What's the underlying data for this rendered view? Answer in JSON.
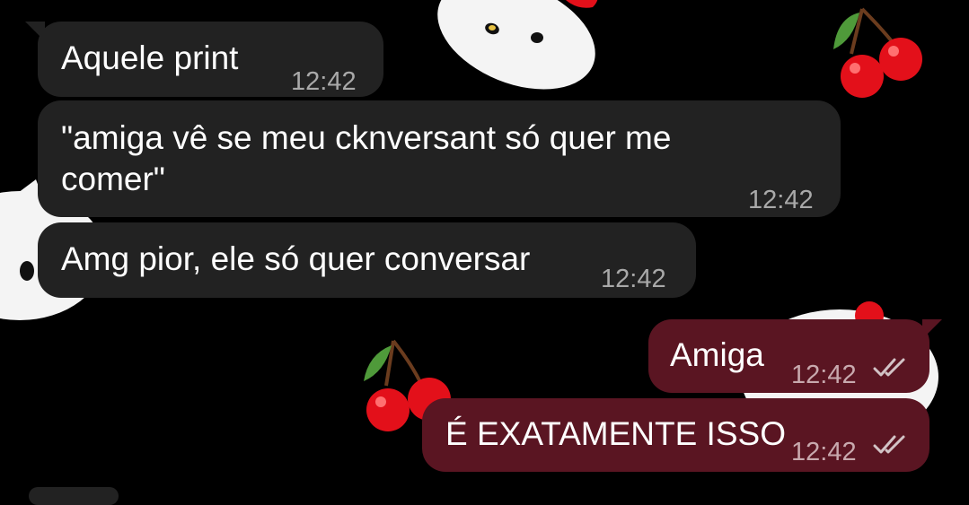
{
  "chat": {
    "messages": [
      {
        "direction": "incoming",
        "text": "Aquele print",
        "time": "12:42"
      },
      {
        "direction": "incoming",
        "text_line1": "\"amiga vê se meu cknversant só quer me",
        "text_line2": "comer\"",
        "time": "12:42"
      },
      {
        "direction": "incoming",
        "text": "Amg pior, ele só quer conversar",
        "time": "12:42"
      },
      {
        "direction": "outgoing",
        "text": "Amiga",
        "time": "12:42",
        "status_icon": "double-check-icon"
      },
      {
        "direction": "outgoing",
        "text": "É EXATAMENTE ISSO",
        "time": "12:42",
        "status_icon": "double-check-icon"
      }
    ]
  },
  "colors": {
    "background": "#000000",
    "incoming_bubble": "#222222",
    "outgoing_bubble": "#5a1522",
    "wallpaper_cherry": "#e3101a",
    "wallpaper_leaf": "#4f9a3a"
  }
}
